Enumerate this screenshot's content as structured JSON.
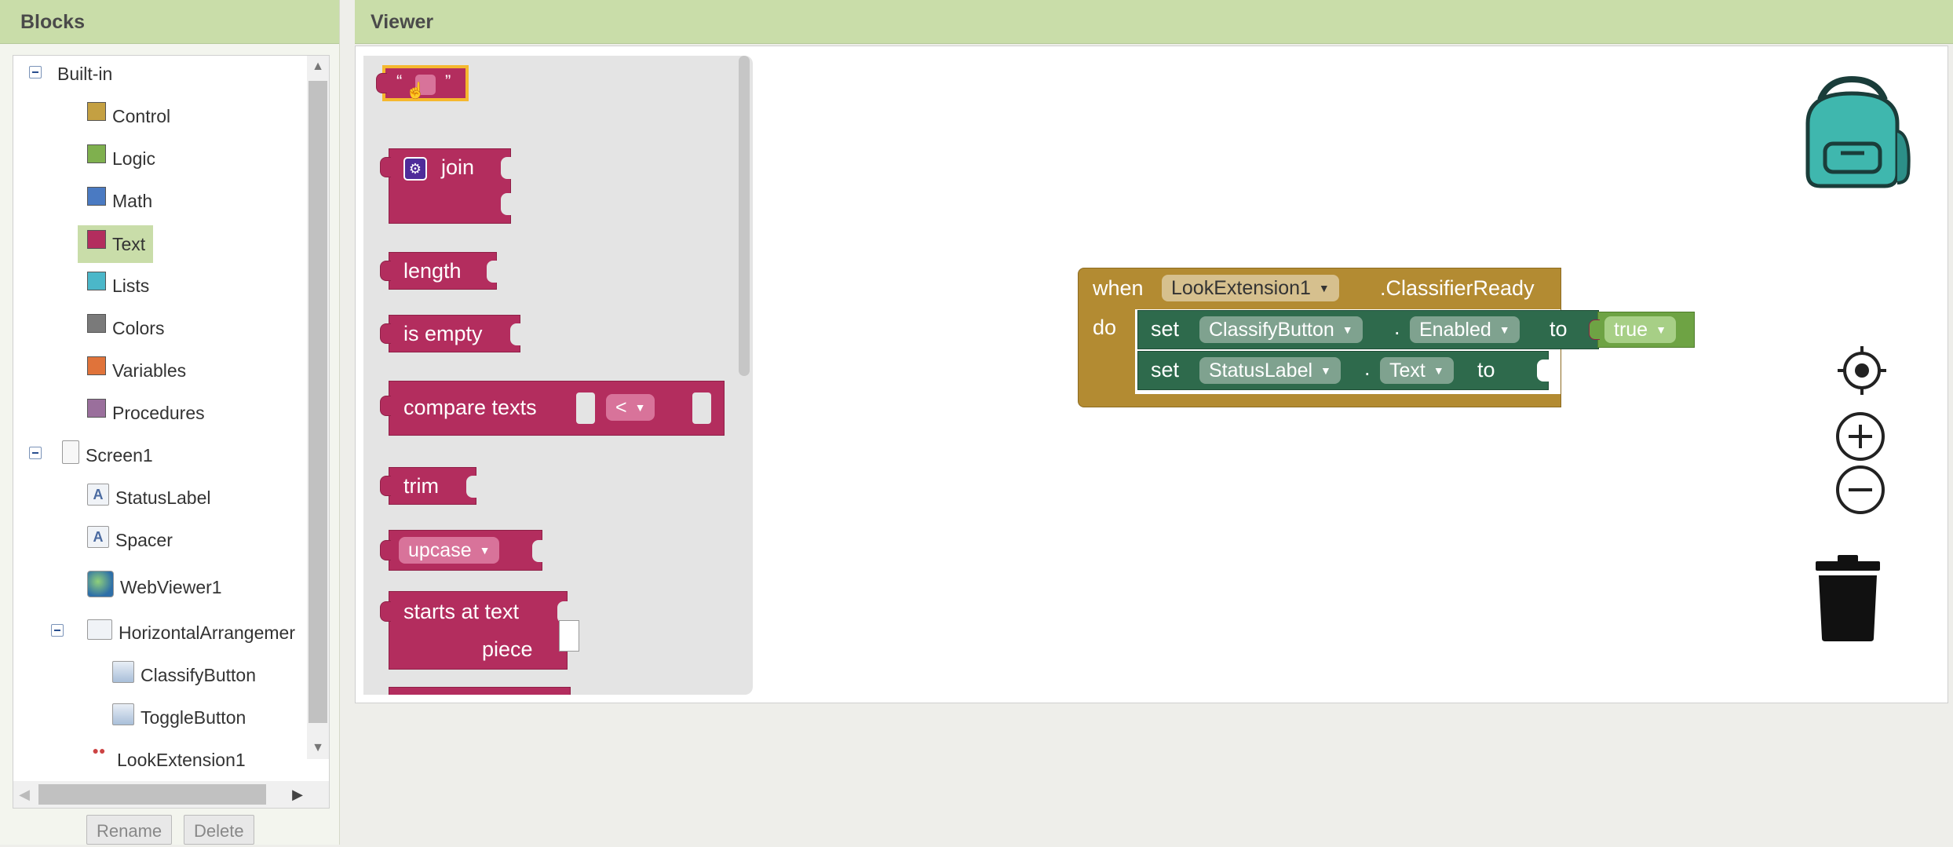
{
  "blocks_panel": {
    "title": "Blocks",
    "tree": {
      "builtin_label": "Built-in",
      "builtin_items": [
        {
          "label": "Control",
          "color": "#c4a042"
        },
        {
          "label": "Logic",
          "color": "#7fb04e"
        },
        {
          "label": "Math",
          "color": "#4a7ac2"
        },
        {
          "label": "Text",
          "color": "#b32d5e"
        },
        {
          "label": "Lists",
          "color": "#4bb7c9"
        },
        {
          "label": "Colors",
          "color": "#7a7a7a"
        },
        {
          "label": "Variables",
          "color": "#e0733a"
        },
        {
          "label": "Procedures",
          "color": "#9a6f9c"
        }
      ],
      "screen_label": "Screen1",
      "components": {
        "status_label": "StatusLabel",
        "spacer": "Spacer",
        "webviewer": "WebViewer1",
        "horizontal_arrangement": "HorizontalArrangemer",
        "classify_button": "ClassifyButton",
        "toggle_button": "ToggleButton",
        "look_extension": "LookExtension1"
      }
    },
    "rename_label": "Rename",
    "delete_label": "Delete"
  },
  "viewer": {
    "title": "Viewer",
    "flyout": {
      "quote_left": "“",
      "quote_right": "”",
      "join_label": "join",
      "length_label": "length",
      "is_empty_label": "is empty",
      "compare_label": "compare texts",
      "compare_op": "<",
      "trim_label": "trim",
      "upcase_label": "upcase",
      "starts_at_label": "starts at  text",
      "piece_label": "piece"
    },
    "event_block": {
      "when": "when",
      "component": "LookExtension1",
      "event": ".ClassifierReady",
      "do": "do",
      "set1": {
        "set": "set",
        "component": "ClassifyButton",
        "dot": ".",
        "property": "Enabled",
        "to": "to",
        "value": "true"
      },
      "set2": {
        "set": "set",
        "component": "StatusLabel",
        "dot": ".",
        "property": "Text",
        "to": "to"
      }
    },
    "icons": {
      "backpack": "backpack-icon",
      "recenter": "target-icon",
      "zoom_in": "plus-icon",
      "zoom_out": "minus-icon",
      "trash": "trash-icon"
    }
  }
}
